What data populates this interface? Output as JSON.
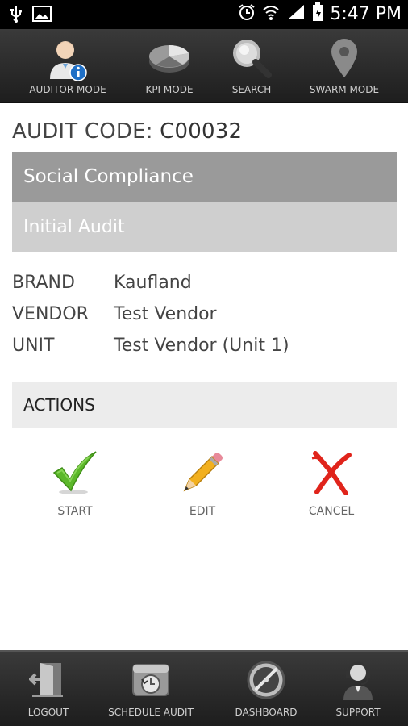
{
  "status_bar": {
    "time": "5:47 PM",
    "icons": [
      "usb-icon",
      "image-icon",
      "alarm-icon",
      "wifi-icon",
      "signal-icon",
      "battery-icon"
    ]
  },
  "top_nav": {
    "items": [
      {
        "label": "AUDITOR MODE",
        "icon": "auditor-icon"
      },
      {
        "label": "KPI MODE",
        "icon": "pie-chart-icon"
      },
      {
        "label": "SEARCH",
        "icon": "search-icon"
      },
      {
        "label": "SWARM MODE",
        "icon": "map-pin-icon"
      }
    ]
  },
  "audit": {
    "code_label": "AUDIT CODE:",
    "code_value": "C00032",
    "type": "Social Compliance",
    "subtype": "Initial Audit"
  },
  "details": [
    {
      "key": "BRAND",
      "value": "Kaufland"
    },
    {
      "key": "VENDOR",
      "value": "Test Vendor"
    },
    {
      "key": "UNIT",
      "value": "Test Vendor (Unit 1)"
    }
  ],
  "actions": {
    "title": "ACTIONS",
    "items": [
      {
        "label": "START",
        "icon": "checkmark-icon"
      },
      {
        "label": "EDIT",
        "icon": "pencil-icon"
      },
      {
        "label": "CANCEL",
        "icon": "red-x-icon"
      }
    ]
  },
  "bottom_nav": {
    "items": [
      {
        "label": "LOGOUT",
        "icon": "logout-door-icon"
      },
      {
        "label": "SCHEDULE AUDIT",
        "icon": "schedule-icon"
      },
      {
        "label": "DASHBOARD",
        "icon": "dashboard-gauge-icon"
      },
      {
        "label": "SUPPORT",
        "icon": "support-headset-icon"
      }
    ]
  },
  "colors": {
    "topbar": "#2b2b2b",
    "band_dark": "#9a9a9a",
    "band_light": "#cfcfcf",
    "actions_bg": "#ececec",
    "check_green": "#5cb82a",
    "cancel_red": "#e0241b"
  }
}
